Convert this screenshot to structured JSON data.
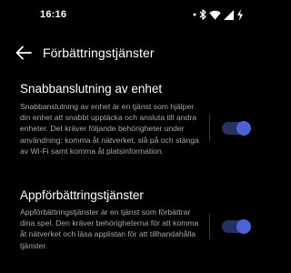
{
  "status_bar": {
    "time": "16:16",
    "icons": [
      "dot-icon",
      "bluetooth-icon",
      "wifi-icon",
      "signal-icon",
      "battery-charging-icon"
    ]
  },
  "app_bar": {
    "back_icon": "arrow-left-icon",
    "title": "Förbättringstjänster"
  },
  "settings": [
    {
      "title": "Snabbanslutning av enhet",
      "description": "Snabbanslutning av enhet är en tjänst som hjälper din enhet att snabbt upptäcka och ansluta till andra enheter. Det kräver följande behörigheter under användning: komma åt nätverket, slå på och stänga av Wi-Fi samt komma åt platsinformation.",
      "enabled": true
    },
    {
      "title": "Appförbättringstjänster",
      "description": "Appförbättringstjänster är en tjänst som förbättrar dina spel. Den kräver behörigheterna för att komma åt nätverket och läsa applistan för att tillhandahålla tjänster.",
      "enabled": true
    }
  ],
  "colors": {
    "background": "#000000",
    "text_primary": "#ffffff",
    "text_secondary": "#a6a6a6",
    "accent": "#4a63d8",
    "toggle_track": "#28305e"
  }
}
